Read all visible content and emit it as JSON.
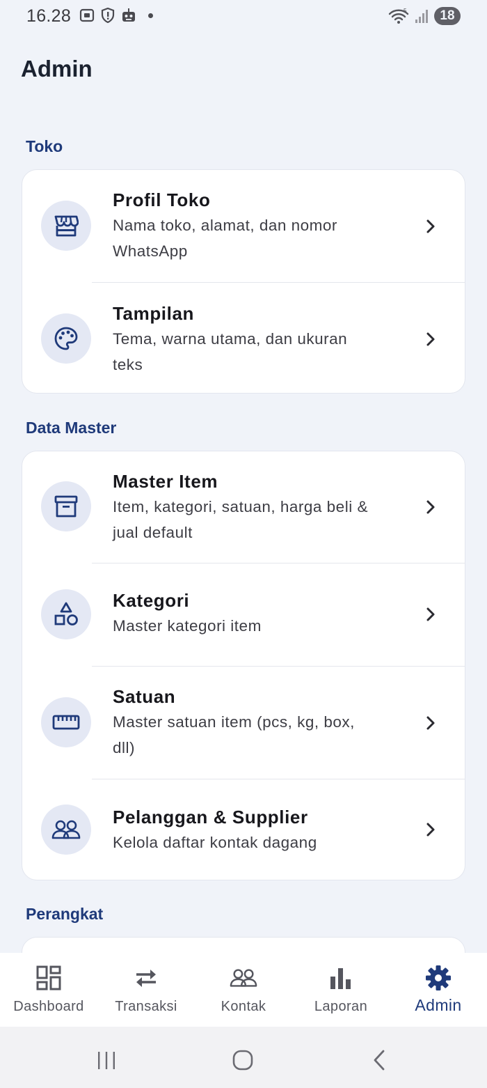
{
  "status_bar": {
    "time": "16.28",
    "battery": "18",
    "icons_left": [
      "screenshot-icon",
      "alert-shield-icon",
      "robot-icon"
    ],
    "icons_right": [
      "wifi-icon",
      "signal-icon"
    ]
  },
  "header": {
    "title": "Admin"
  },
  "sections": [
    {
      "title": "Toko",
      "items": [
        {
          "title": "Profil Toko",
          "subtitle_line1": "Nama toko, alamat, dan nomor",
          "subtitle_line2": "WhatsApp",
          "icon": "store-icon"
        },
        {
          "title": "Tampilan",
          "subtitle_line1": "Tema, warna utama, dan ukuran",
          "subtitle_line2": "teks",
          "icon": "palette-icon"
        }
      ]
    },
    {
      "title": "Data Master",
      "items": [
        {
          "title": "Master Item",
          "subtitle_line1": "Item, kategori, satuan, harga beli &",
          "subtitle_line2": "jual default",
          "icon": "archive-box-icon"
        },
        {
          "title": "Kategori",
          "subtitle_line1": "Master kategori item",
          "icon": "shapes-icon"
        },
        {
          "title": "Satuan",
          "subtitle_line1": "Master satuan item (pcs, kg, box,",
          "subtitle_line2": "dll)",
          "icon": "ruler-icon"
        },
        {
          "title": "Pelanggan & Supplier",
          "subtitle_line1": "Kelola daftar kontak dagang",
          "icon": "people-icon"
        }
      ]
    },
    {
      "title": "Perangkat"
    }
  ],
  "bottom_nav": [
    {
      "label": "Dashboard",
      "icon": "dashboard-icon"
    },
    {
      "label": "Transaksi",
      "icon": "swap-arrows-icon"
    },
    {
      "label": "Kontak",
      "icon": "people-icon"
    },
    {
      "label": "Laporan",
      "icon": "bar-chart-icon"
    },
    {
      "label": "Admin",
      "icon": "gear-icon",
      "active": true
    }
  ],
  "colors": {
    "accent": "#1f3a7a",
    "background": "#f0f3f9",
    "icon_circle": "#e4e8f4",
    "nav_inactive": "#55565e"
  }
}
